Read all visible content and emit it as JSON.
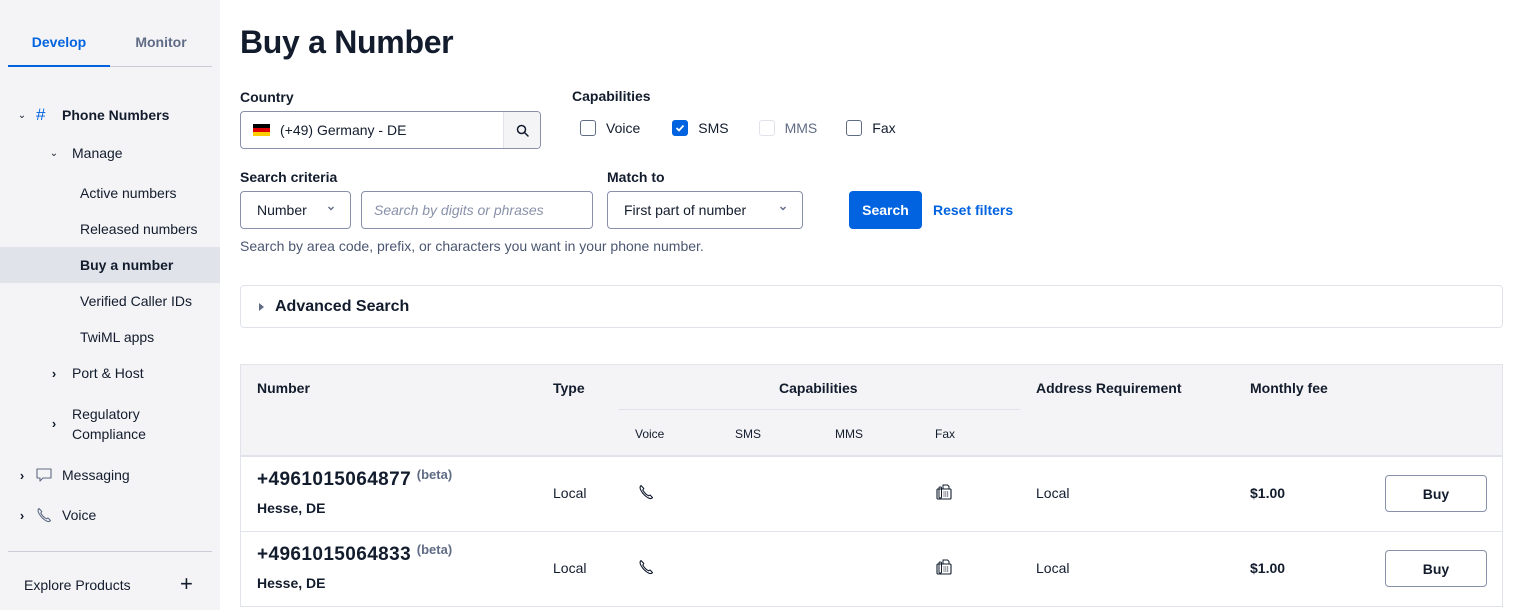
{
  "sidebar": {
    "tabs": [
      {
        "label": "Develop",
        "active": true
      },
      {
        "label": "Monitor",
        "active": false
      }
    ],
    "nav": {
      "phone_numbers": "Phone Numbers",
      "manage": "Manage",
      "active_numbers": "Active numbers",
      "released_numbers": "Released numbers",
      "buy_a_number": "Buy a number",
      "verified_caller_ids": "Verified Caller IDs",
      "twiml_apps": "TwiML apps",
      "port_host": "Port & Host",
      "regulatory_line1": "Regulatory",
      "regulatory_line2": "Compliance",
      "messaging": "Messaging",
      "voice": "Voice"
    },
    "explore_products": "Explore Products",
    "explore_plus": "+"
  },
  "page": {
    "title": "Buy a Number"
  },
  "filters": {
    "country_label": "Country",
    "country_value": "(+49) Germany - DE",
    "capabilities_label": "Capabilities",
    "capabilities": [
      {
        "label": "Voice",
        "checked": false,
        "disabled": false
      },
      {
        "label": "SMS",
        "checked": true,
        "disabled": false
      },
      {
        "label": "MMS",
        "checked": false,
        "disabled": true
      },
      {
        "label": "Fax",
        "checked": false,
        "disabled": false
      }
    ],
    "search_criteria_label": "Search criteria",
    "search_criteria_value": "Number",
    "search_placeholder": "Search by digits or phrases",
    "match_to_label": "Match to",
    "match_to_value": "First part of number",
    "search_button": "Search",
    "reset_filters": "Reset filters",
    "help_text": "Search by area code, prefix, or characters you want in your phone number.",
    "advanced_search": "Advanced Search"
  },
  "table": {
    "headers": {
      "number": "Number",
      "type": "Type",
      "capabilities": "Capabilities",
      "voice": "Voice",
      "sms": "SMS",
      "mms": "MMS",
      "fax": "Fax",
      "address_requirement": "Address Requirement",
      "monthly_fee": "Monthly fee"
    },
    "rows": [
      {
        "number": "+4961015064877",
        "beta": "(beta)",
        "region": "Hesse, DE",
        "type": "Local",
        "voice": true,
        "sms": false,
        "mms": false,
        "fax": true,
        "address_requirement": "Local",
        "monthly_fee": "$1.00",
        "buy_label": "Buy"
      },
      {
        "number": "+4961015064833",
        "beta": "(beta)",
        "region": "Hesse, DE",
        "type": "Local",
        "voice": true,
        "sms": false,
        "mms": false,
        "fax": true,
        "address_requirement": "Local",
        "monthly_fee": "$1.00",
        "buy_label": "Buy"
      }
    ]
  },
  "colors": {
    "accent": "#0263e0",
    "sidebar_bg": "#f4f4f6",
    "selected_bg": "#e1e3ea",
    "text": "#121c2d"
  }
}
